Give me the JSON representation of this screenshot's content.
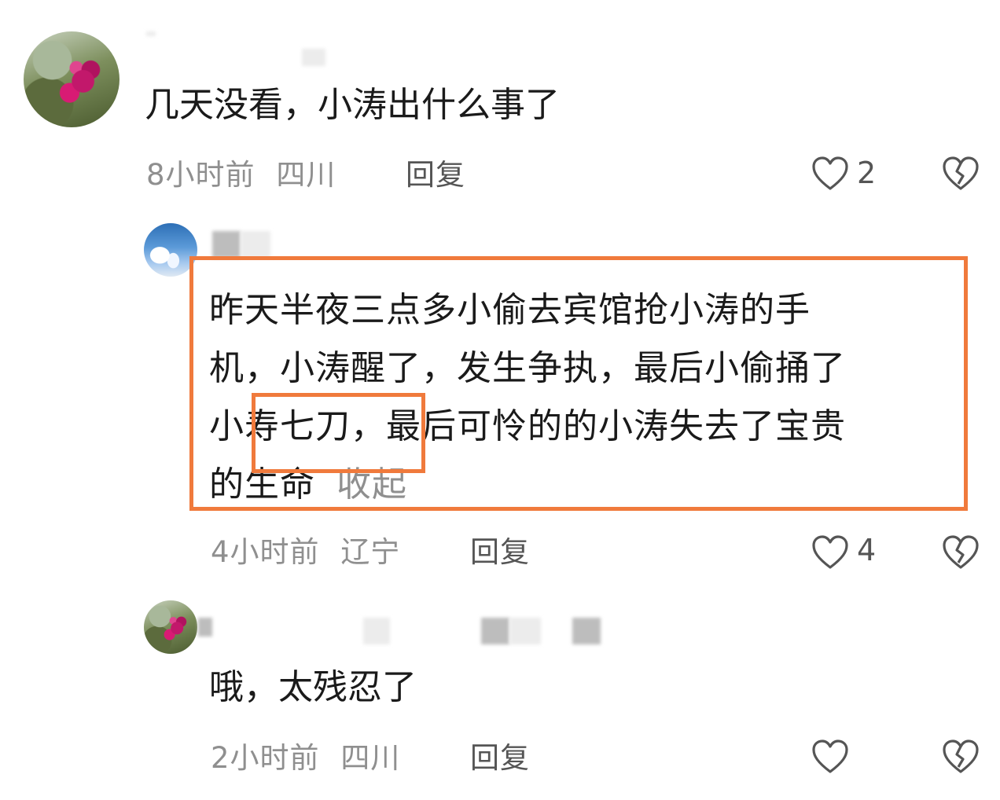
{
  "comments": [
    {
      "text": "几天没看，小涛出什么事了",
      "time": "8小时前",
      "location": "四川",
      "reply_label": "回复",
      "likes": "2"
    },
    {
      "lines": [
        "昨天半夜三点多小偷去宾馆抢小涛的手",
        "机，小涛醒了，发生争执，最后小偷捅了",
        "小寿七刀，最后可怜的的小涛失去了宝贵",
        "的生命"
      ],
      "collapse_label": "收起",
      "time": "4小时前",
      "location": "辽宁",
      "reply_label": "回复",
      "likes": "4"
    },
    {
      "text": "哦，太残忍了",
      "time": "2小时前",
      "location": "四川",
      "reply_label": "回复"
    }
  ],
  "colors": {
    "highlight": "#f07a3c",
    "meta": "#8f8f8f"
  },
  "icons": {
    "like": "heart-outline-icon",
    "dislike": "broken-heart-icon"
  }
}
